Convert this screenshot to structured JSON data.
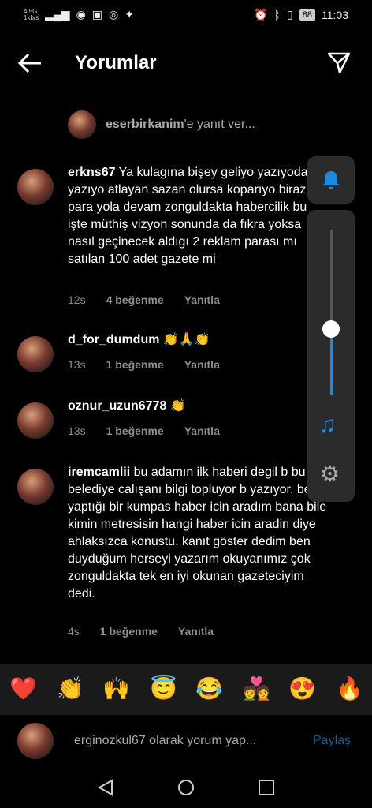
{
  "status": {
    "network": "4.5G",
    "network_speed": "1kb/s",
    "battery": "88",
    "time": "11:03"
  },
  "header": {
    "title": "Yorumlar"
  },
  "reply_to": {
    "username": "eserbirkanim",
    "suffix": "'e yanıt ver..."
  },
  "comments": [
    {
      "username": "erkns67",
      "text": "Ya kulagına bişey geliyo yazıyoda yazıyo atlayan sazan olursa koparıyo biraz para yola devam zonguldakta habercilik bu işte müthiş vizyon sonunda da fıkra yoksa nasıl geçinecek aldıgı 2 reklam parası mı satılan 100 adet gazete mi",
      "time": "12s",
      "likes": "4 beğenme",
      "reply": "Yanıtla"
    },
    {
      "username": "d_for_dumdum",
      "text": "👏🙏👏",
      "time": "13s",
      "likes": "1 beğenme",
      "reply": "Yanıtla"
    },
    {
      "username": "oznur_uzun6778",
      "text": "👏",
      "time": "13s",
      "likes": "1 beğenme",
      "reply": "Yanıtla"
    },
    {
      "username": "iremcamlii",
      "text": "bu adamın ilk haberi degil b bu eşi belediye calışanı bilgi topluyor b yazıyor. ben yaptığı bir kumpas haber icin aradım bana bile kimin metresisin hangi haber icin aradin diye ahlaksızca konustu. kanıt göster dedim ben duyduğum herseyi yazarım okuyanımız çok zonguldakta tek en iyi okunan gazeteciyim dedi.",
      "time": "4s",
      "likes": "1 beğenme",
      "reply": "Yanıtla"
    }
  ],
  "volume": {
    "level": 0.4
  },
  "emojis": [
    "❤️",
    "👏",
    "🙌",
    "😇",
    "😂",
    "💑",
    "😍",
    "🔥"
  ],
  "composer": {
    "placeholder": "erginozkul67 olarak yorum yap...",
    "share": "Paylaş"
  },
  "colors": {
    "accent": "#1e88e5",
    "background": "#000000",
    "muted": "#8e8e8e"
  }
}
